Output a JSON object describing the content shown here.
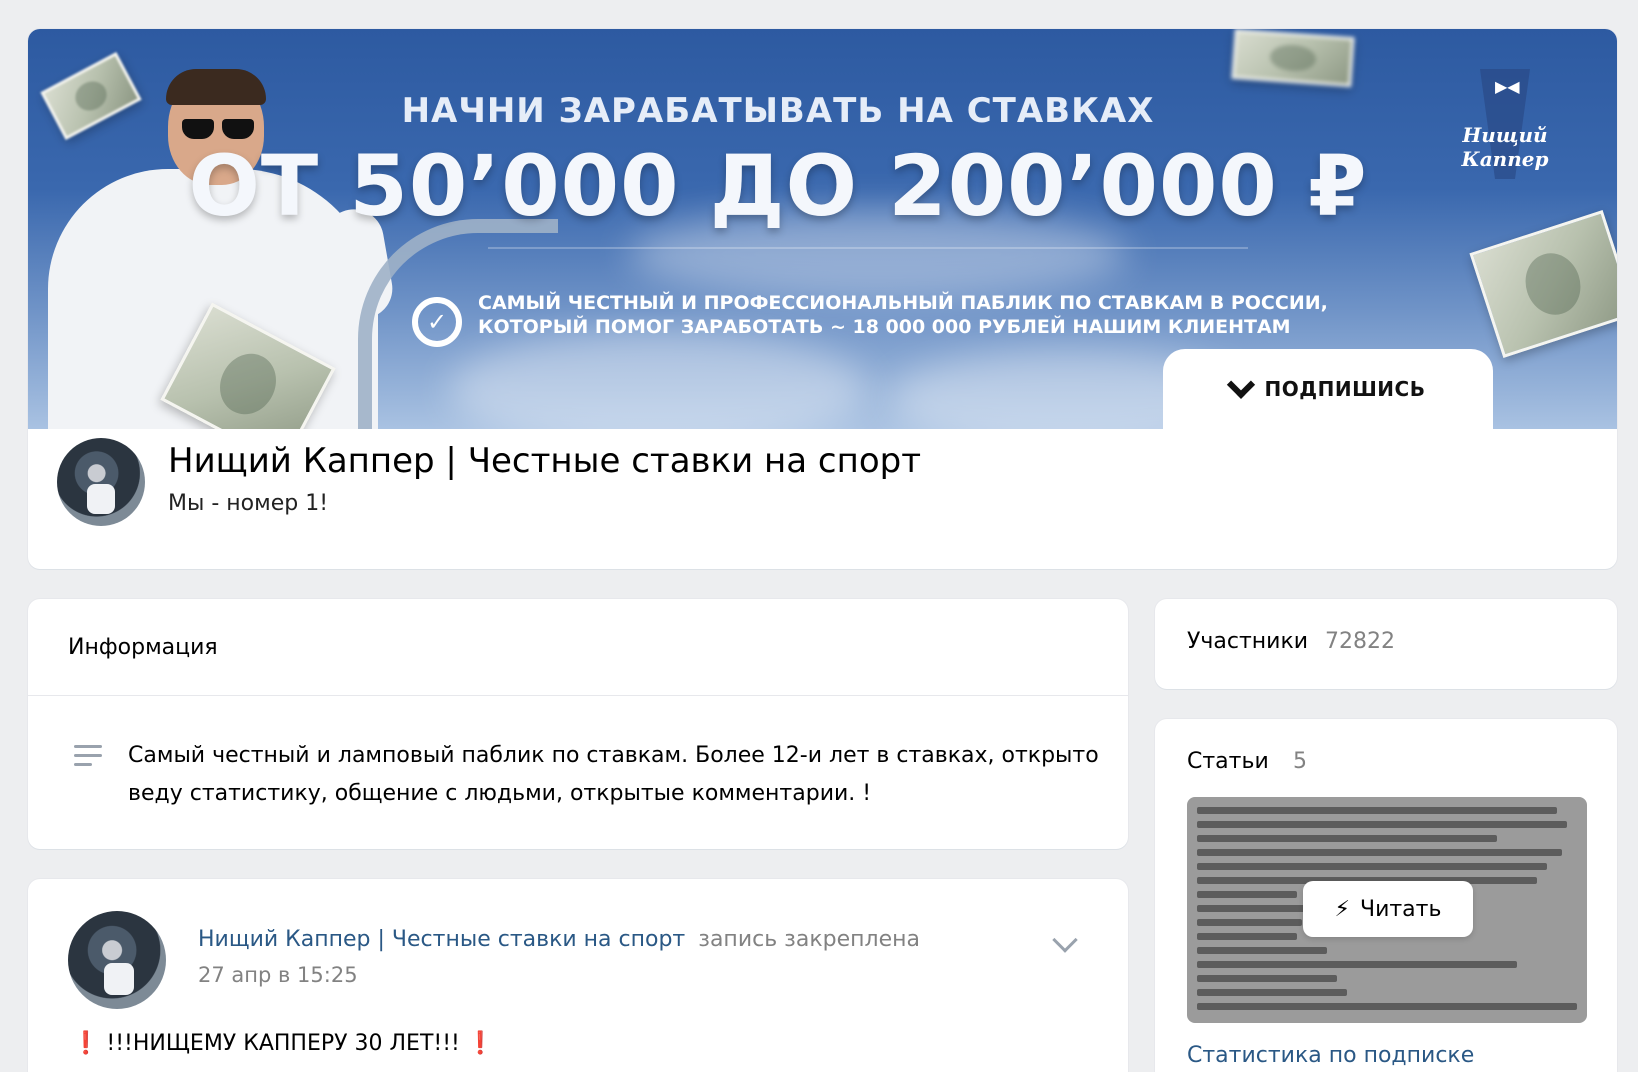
{
  "cover": {
    "headline_1": "НАЧНИ ЗАРАБАТЫВАТЬ НА СТАВКАХ",
    "headline_2": "ОТ 50’000 ДО 200’000 ₽",
    "tagline_1": "САМЫЙ ЧЕСТНЫЙ И ПРОФЕССИОНАЛЬНЫЙ ПАБЛИК ПО СТАВКАМ В РОССИИ,",
    "tagline_2": "КОТОРЫЙ ПОМОГ ЗАРАБОТАТЬ ~ 18 000 000 РУБЛЕЙ НАШИМ КЛИЕНТАМ",
    "logo_text": "Нищий Каппер",
    "subscribe_label": "ПОДПИШИСЬ"
  },
  "group": {
    "title": "Нищий Каппер | Честные ставки на спорт",
    "status": "Мы - номер 1!"
  },
  "info": {
    "title": "Информация",
    "description": "Самый честный и ламповый паблик по ставкам. Более 12-и лет в ставках, открыто веду статистику, общение с людьми, открытые комментарии. !"
  },
  "post": {
    "author": "Нищий Каппер | Честные ставки на спорт",
    "pinned": "запись закреплена",
    "date": "27 апр в 15:25",
    "text_mark_left": "❗",
    "text": "!!!НИЩЕМУ КАППЕРУ 30 ЛЕТ!!!",
    "text_mark_right": "❗"
  },
  "members": {
    "label": "Участники",
    "count": "72822"
  },
  "articles": {
    "label": "Статьи",
    "count": "5",
    "read_label": "Читать",
    "stats_link": "Статистика по подписке"
  },
  "colors": {
    "link": "#2a5885",
    "secondary": "#828282",
    "background": "#edeef0"
  }
}
